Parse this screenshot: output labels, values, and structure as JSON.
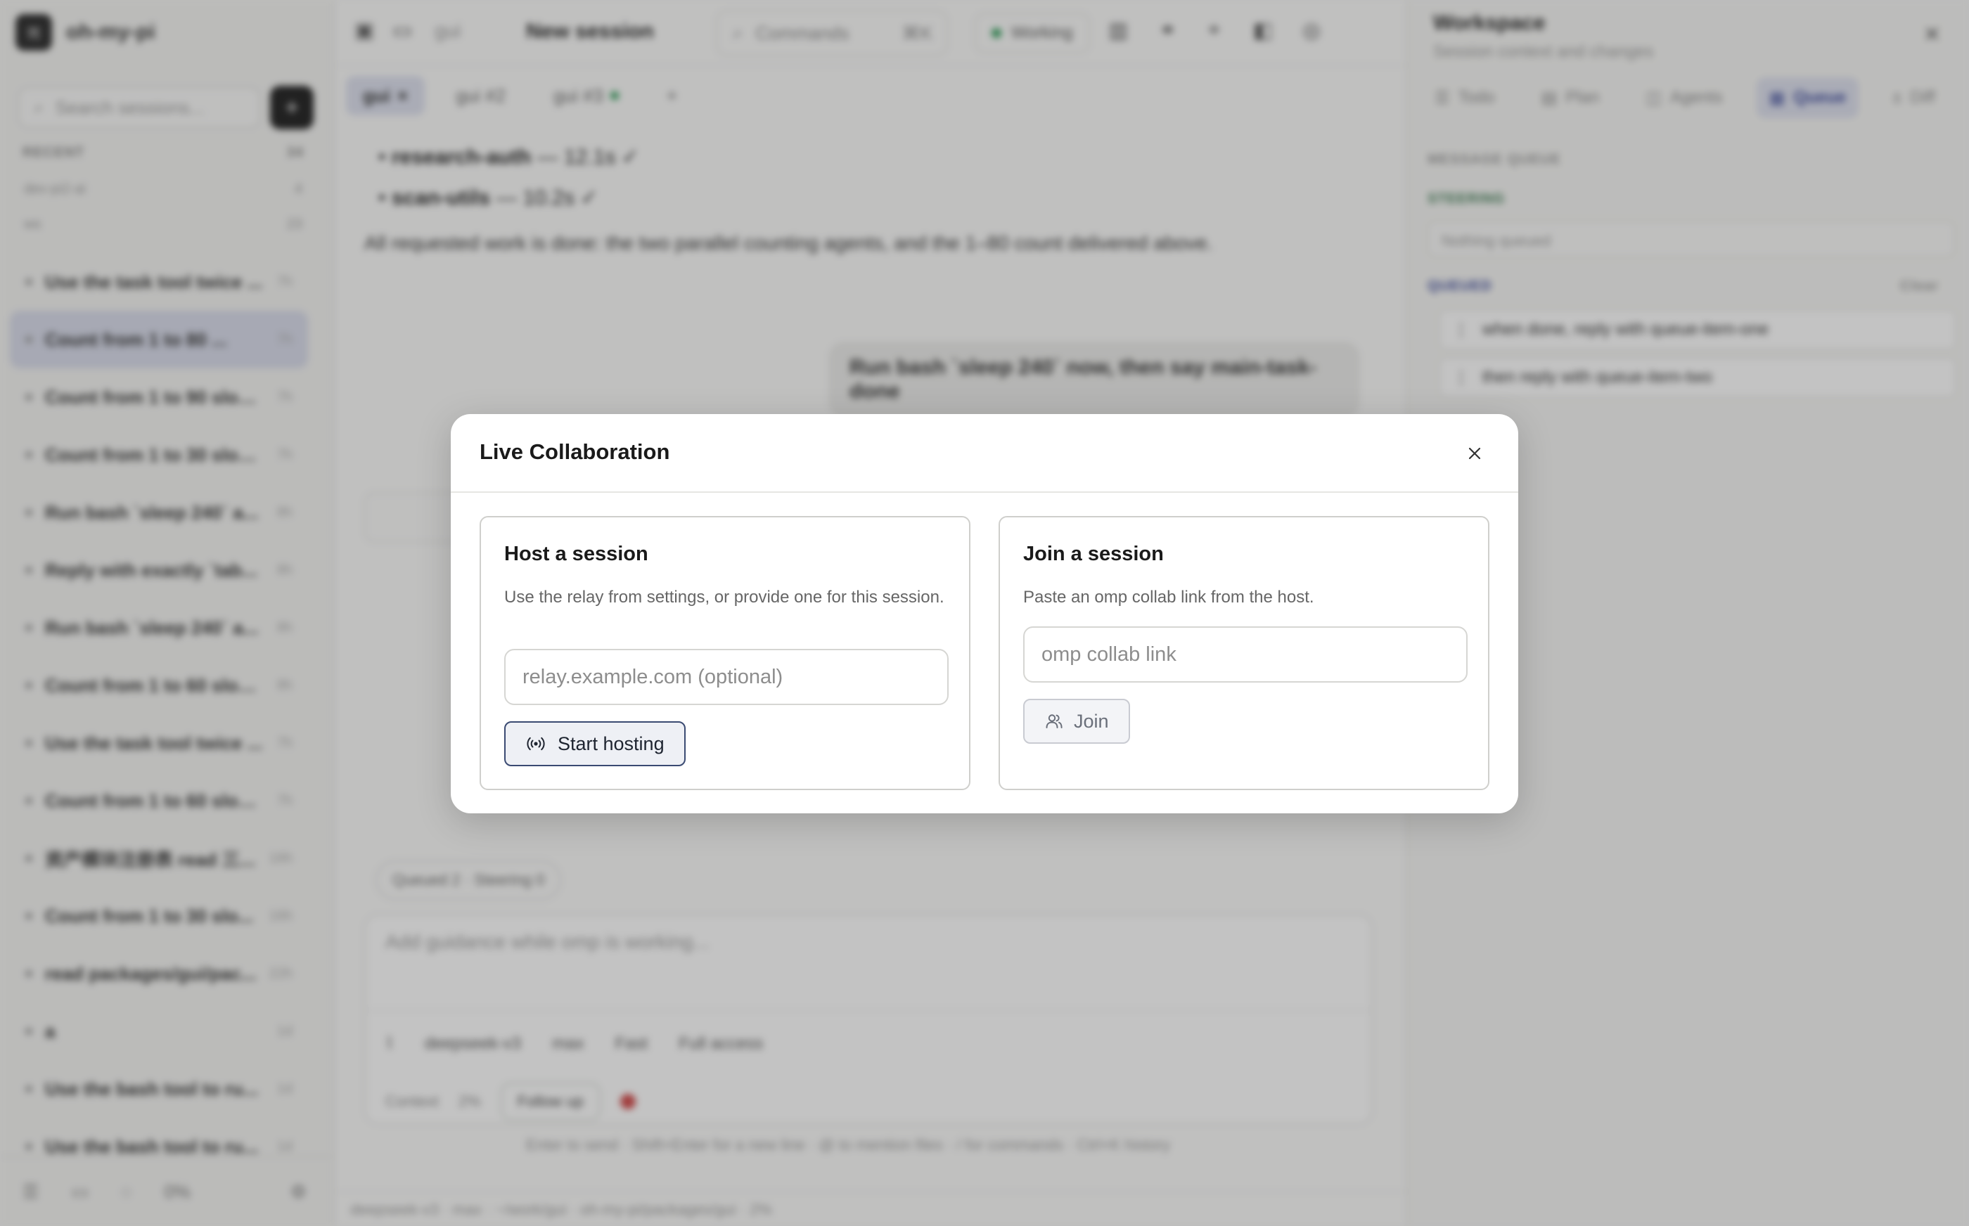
{
  "sidebar": {
    "app_name": "oh-my-pi",
    "search_placeholder": "Search sessions...",
    "section_label": "RECENT",
    "section_count": "34",
    "groups": [
      {
        "label": "dev-pi2-ai",
        "count": "4"
      },
      {
        "label": "ws",
        "count": "23"
      }
    ],
    "sessions": [
      {
        "title": "Use the task tool twice ...",
        "time": "7h"
      },
      {
        "title": "Count from 1 to 80 ...",
        "time": "7h"
      },
      {
        "title": "Count from 1 to 90 slow...",
        "time": "7h"
      },
      {
        "title": "Count from 1 to 30 slow...",
        "time": "7h"
      },
      {
        "title": "Run bash `sleep 240` a...",
        "time": "8h"
      },
      {
        "title": "Reply with exactly `tab...",
        "time": "8h"
      },
      {
        "title": "Run bash `sleep 240` a...",
        "time": "8h"
      },
      {
        "title": "Count from 1 to 60 slow...",
        "time": "8h"
      },
      {
        "title": "Use the task tool twice ...",
        "time": "7h"
      },
      {
        "title": "Count from 1 to 60 slow...",
        "time": "7h"
      },
      {
        "title": "资产模块注册表 read 三...",
        "time": "16h"
      },
      {
        "title": "Count from 1 to 30 slo...",
        "time": "16h"
      },
      {
        "title": "read packages/gui/pac...",
        "time": "22h"
      },
      {
        "title": "a",
        "time": "1d"
      },
      {
        "title": "Use the bash tool to ru...",
        "time": "1d"
      },
      {
        "title": "Use the bash tool to ru...",
        "time": "1d"
      }
    ],
    "footer_zoom": "0%"
  },
  "main": {
    "breadcrumb": "gui",
    "session_title": "New session",
    "commands_label": "Commands",
    "commands_shortcut": "⌘K",
    "status_label": "Working",
    "tabs": [
      {
        "label": "gui"
      },
      {
        "label": "gui #2"
      },
      {
        "label": "gui #3"
      }
    ],
    "chat_lines": [
      {
        "name": "research-auth",
        "detail": "— 12.1s ✓"
      },
      {
        "name": "scan-utils",
        "detail": "— 10.2s ✓"
      }
    ],
    "chat_paragraph": "All requested work is done: the two parallel counting agents, and the 1–80 count delivered above.",
    "user_bubble": "Run bash `sleep 240` now, then say main-task-done",
    "chips": "Queued 2 · Steering 0",
    "composer_placeholder": "Add guidance while omp is working...",
    "composer_model": "deepseek-v3",
    "composer_thinking": "max",
    "composer_fast": "Fast",
    "composer_access": "Full access",
    "context_label": "Context",
    "context_pct": "2%",
    "followup_label": "Follow up",
    "hint": "Enter to send · Shift+Enter for a new line · @ to mention files · / for commands · Ctrl+K history",
    "statusbar": "deepseek-v3 · max · ~/work/gui · oh-my-pi/packages/gui · 2%"
  },
  "workspace": {
    "title": "Workspace",
    "subtitle": "Session context and changes",
    "tabs": [
      {
        "label": "Todo"
      },
      {
        "label": "Plan"
      },
      {
        "label": "Agents"
      },
      {
        "label": "Queue"
      },
      {
        "label": "Diff"
      }
    ],
    "section_message_queue": "MESSAGE QUEUE",
    "section_steering": "STEERING",
    "steering_empty": "Nothing queued",
    "section_queued": "QUEUED",
    "clear_label": "Clear",
    "queued_items": [
      "when done, reply with queue-item-one",
      "then reply with queue-item-two"
    ]
  },
  "modal": {
    "title": "Live Collaboration",
    "host": {
      "title": "Host a session",
      "description": "Use the relay from settings, or provide one for this session.",
      "input_placeholder": "relay.example.com (optional)",
      "button_label": "Start hosting"
    },
    "join": {
      "title": "Join a session",
      "description": "Paste an omp collab link from the host.",
      "input_placeholder": "omp collab link",
      "button_label": "Join"
    }
  }
}
